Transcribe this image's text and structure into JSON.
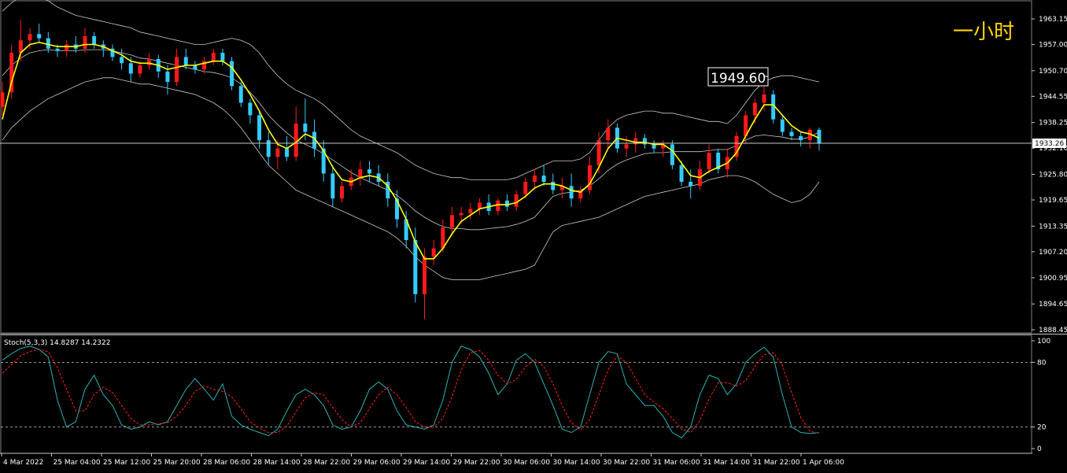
{
  "period_label": "一小时",
  "main_panel": {
    "price_axis_ticks": [
      "1963.15",
      "1957.00",
      "1950.70",
      "1944.55",
      "1938.25",
      "1932.10",
      "1925.80",
      "1919.65",
      "1913.35",
      "1907.20",
      "1900.95",
      "1894.65",
      "1888.45"
    ],
    "current_price": "1933.26",
    "annotation_price": "1949.60",
    "colors": {
      "bull": "#ff1a1a",
      "bear": "#33ccff",
      "ma": "#ffff00",
      "band": "#c8c8c8",
      "hline": "#c8c8c8",
      "current_box": "#ffffff"
    }
  },
  "stoch_panel": {
    "title": "Stoch(5,3,3) 14.8287 14.2322",
    "axis_ticks": [
      "100",
      "80",
      "20",
      "0"
    ],
    "colors": {
      "main": "#2bb3b3",
      "signal": "#ff2020"
    }
  },
  "time_axis": [
    "4 Mar 2022",
    "25 Mar 04:00",
    "25 Mar 12:00",
    "25 Mar 20:00",
    "28 Mar 06:00",
    "28 Mar 14:00",
    "28 Mar 22:00",
    "29 Mar 06:00",
    "29 Mar 14:00",
    "29 Mar 22:00",
    "30 Mar 06:00",
    "30 Mar 14:00",
    "30 Mar 22:00",
    "31 Mar 06:00",
    "31 Mar 14:00",
    "31 Mar 22:00",
    "1 Apr 06:00"
  ],
  "chart_data": {
    "type": "candlestick",
    "title": "",
    "indicators": [
      "Bollinger Bands",
      "Moving Average",
      "Stoch(5,3,3)"
    ],
    "y_range": [
      1888.45,
      1966.0
    ],
    "candles_ohlc": [
      [
        1942.0,
        1948.0,
        1940.0,
        1945.5
      ],
      [
        1945.5,
        1957.0,
        1944.0,
        1955.0
      ],
      [
        1955.0,
        1963.0,
        1953.0,
        1958.0
      ],
      [
        1958.0,
        1961.0,
        1956.0,
        1959.5
      ],
      [
        1959.5,
        1962.0,
        1957.5,
        1958.5
      ],
      [
        1958.5,
        1960.0,
        1955.0,
        1956.0
      ],
      [
        1956.0,
        1957.0,
        1954.0,
        1955.5
      ],
      [
        1955.5,
        1958.0,
        1954.0,
        1957.0
      ],
      [
        1957.0,
        1959.0,
        1955.0,
        1956.0
      ],
      [
        1956.0,
        1961.0,
        1955.0,
        1959.0
      ],
      [
        1959.0,
        1960.0,
        1956.0,
        1957.0
      ],
      [
        1957.0,
        1958.0,
        1954.0,
        1956.0
      ],
      [
        1956.0,
        1957.0,
        1953.0,
        1954.0
      ],
      [
        1954.0,
        1956.0,
        1951.0,
        1952.5
      ],
      [
        1952.5,
        1954.0,
        1948.0,
        1950.0
      ],
      [
        1950.0,
        1953.0,
        1949.0,
        1952.0
      ],
      [
        1952.0,
        1955.0,
        1951.0,
        1953.5
      ],
      [
        1953.5,
        1954.5,
        1949.0,
        1950.5
      ],
      [
        1950.5,
        1952.0,
        1945.0,
        1948.0
      ],
      [
        1948.0,
        1956.0,
        1947.0,
        1954.0
      ],
      [
        1954.0,
        1956.0,
        1951.0,
        1952.0
      ],
      [
        1952.0,
        1953.0,
        1950.0,
        1951.0
      ],
      [
        1951.0,
        1954.0,
        1950.0,
        1953.0
      ],
      [
        1953.0,
        1956.0,
        1952.0,
        1955.0
      ],
      [
        1955.0,
        1956.0,
        1952.0,
        1953.0
      ],
      [
        1953.0,
        1954.0,
        1946.0,
        1947.0
      ],
      [
        1947.0,
        1948.0,
        1942.0,
        1943.0
      ],
      [
        1943.0,
        1944.0,
        1938.0,
        1940.0
      ],
      [
        1940.0,
        1941.0,
        1932.0,
        1934.0
      ],
      [
        1934.0,
        1936.0,
        1928.0,
        1930.0
      ],
      [
        1930.0,
        1934.0,
        1927.0,
        1932.0
      ],
      [
        1932.0,
        1935.0,
        1929.0,
        1930.0
      ],
      [
        1930.0,
        1942.0,
        1929.0,
        1938.0
      ],
      [
        1938.0,
        1944.0,
        1934.0,
        1936.0
      ],
      [
        1936.0,
        1939.0,
        1930.0,
        1932.0
      ],
      [
        1932.0,
        1934.0,
        1924.0,
        1926.0
      ],
      [
        1926.0,
        1928.0,
        1918.0,
        1920.0
      ],
      [
        1920.0,
        1924.0,
        1919.0,
        1923.0
      ],
      [
        1923.0,
        1927.0,
        1922.0,
        1925.0
      ],
      [
        1925.0,
        1929.0,
        1923.0,
        1927.0
      ],
      [
        1927.0,
        1929.0,
        1924.0,
        1926.0
      ],
      [
        1926.0,
        1928.0,
        1923.0,
        1924.0
      ],
      [
        1924.0,
        1926.0,
        1918.0,
        1920.0
      ],
      [
        1920.0,
        1922.0,
        1913.0,
        1915.0
      ],
      [
        1915.0,
        1917.0,
        1908.0,
        1910.0
      ],
      [
        1910.0,
        1913.0,
        1895.0,
        1897.0
      ],
      [
        1897.0,
        1908.0,
        1891.0,
        1906.0
      ],
      [
        1906.0,
        1910.0,
        1904.0,
        1908.0
      ],
      [
        1908.0,
        1915.0,
        1907.0,
        1913.0
      ],
      [
        1913.0,
        1918.0,
        1911.0,
        1916.0
      ],
      [
        1916.0,
        1918.0,
        1914.0,
        1916.5
      ],
      [
        1916.5,
        1919.0,
        1915.0,
        1917.5
      ],
      [
        1917.5,
        1920.0,
        1916.0,
        1919.0
      ],
      [
        1919.0,
        1921.0,
        1916.0,
        1917.0
      ],
      [
        1917.0,
        1920.0,
        1916.0,
        1919.5
      ],
      [
        1919.5,
        1921.0,
        1917.0,
        1918.0
      ],
      [
        1918.0,
        1922.0,
        1917.0,
        1921.0
      ],
      [
        1921.0,
        1925.0,
        1920.0,
        1924.0
      ],
      [
        1924.0,
        1927.0,
        1922.0,
        1925.5
      ],
      [
        1925.5,
        1928.0,
        1923.0,
        1924.0
      ],
      [
        1924.0,
        1926.0,
        1921.0,
        1922.0
      ],
      [
        1922.0,
        1925.0,
        1920.0,
        1923.0
      ],
      [
        1923.0,
        1926.0,
        1918.0,
        1920.0
      ],
      [
        1920.0,
        1923.0,
        1919.0,
        1922.0
      ],
      [
        1922.0,
        1930.0,
        1921.0,
        1928.0
      ],
      [
        1928.0,
        1936.0,
        1926.0,
        1934.0
      ],
      [
        1934.0,
        1939.0,
        1932.0,
        1937.0
      ],
      [
        1937.0,
        1938.0,
        1931.0,
        1932.0
      ],
      [
        1932.0,
        1935.0,
        1930.0,
        1933.0
      ],
      [
        1933.0,
        1936.0,
        1931.0,
        1934.5
      ],
      [
        1934.5,
        1935.5,
        1932.0,
        1933.0
      ],
      [
        1933.0,
        1934.0,
        1931.0,
        1932.0
      ],
      [
        1932.0,
        1934.0,
        1930.0,
        1933.0
      ],
      [
        1933.0,
        1934.0,
        1927.0,
        1928.0
      ],
      [
        1928.0,
        1929.0,
        1923.0,
        1924.0
      ],
      [
        1924.0,
        1927.0,
        1920.0,
        1923.0
      ],
      [
        1923.0,
        1929.0,
        1922.0,
        1927.0
      ],
      [
        1927.0,
        1933.0,
        1926.0,
        1931.0
      ],
      [
        1931.0,
        1932.0,
        1926.0,
        1927.0
      ],
      [
        1927.0,
        1932.0,
        1925.0,
        1930.0
      ],
      [
        1930.0,
        1936.0,
        1929.0,
        1935.0
      ],
      [
        1935.0,
        1941.0,
        1933.0,
        1940.0
      ],
      [
        1940.0,
        1944.0,
        1938.0,
        1943.0
      ],
      [
        1943.0,
        1949.6,
        1941.0,
        1945.0
      ],
      [
        1945.0,
        1946.0,
        1938.0,
        1939.0
      ],
      [
        1939.0,
        1940.0,
        1935.0,
        1936.0
      ],
      [
        1936.0,
        1937.0,
        1934.0,
        1935.0
      ],
      [
        1935.0,
        1936.0,
        1932.5,
        1934.0
      ],
      [
        1934.0,
        1937.0,
        1932.0,
        1936.5
      ],
      [
        1936.5,
        1937.0,
        1931.5,
        1933.26
      ]
    ],
    "ma": [
      1939.0,
      1948.0,
      1955.0,
      1957.0,
      1957.5,
      1957.0,
      1956.5,
      1956.5,
      1956.5,
      1957.0,
      1957.0,
      1956.5,
      1955.5,
      1954.5,
      1953.0,
      1952.5,
      1952.5,
      1952.0,
      1951.0,
      1951.5,
      1952.0,
      1952.0,
      1952.5,
      1953.0,
      1953.0,
      1951.5,
      1948.5,
      1945.0,
      1941.0,
      1936.5,
      1933.0,
      1932.0,
      1933.5,
      1935.5,
      1934.5,
      1931.5,
      1927.5,
      1924.5,
      1924.0,
      1925.0,
      1925.5,
      1925.0,
      1923.0,
      1919.5,
      1915.0,
      1909.5,
      1905.5,
      1905.5,
      1908.0,
      1911.5,
      1914.5,
      1916.0,
      1917.5,
      1918.0,
      1918.5,
      1918.5,
      1919.0,
      1920.5,
      1922.5,
      1923.5,
      1923.5,
      1923.0,
      1922.0,
      1921.5,
      1923.5,
      1927.5,
      1932.0,
      1934.5,
      1934.0,
      1933.5,
      1933.5,
      1933.0,
      1933.0,
      1931.5,
      1928.5,
      1925.5,
      1925.0,
      1926.5,
      1927.5,
      1928.5,
      1931.0,
      1935.0,
      1939.0,
      1942.5,
      1942.5,
      1940.0,
      1937.5,
      1936.0,
      1935.5,
      1934.5
    ],
    "bb_upper": [
      1965.0,
      1967.0,
      1968.5,
      1969.0,
      1968.5,
      1967.5,
      1966.0,
      1965.0,
      1964.0,
      1963.5,
      1963.0,
      1962.5,
      1962.0,
      1961.5,
      1961.0,
      1960.0,
      1959.5,
      1959.0,
      1958.5,
      1958.0,
      1957.5,
      1957.0,
      1957.0,
      1957.5,
      1958.0,
      1958.5,
      1958.0,
      1957.0,
      1955.0,
      1952.0,
      1949.5,
      1947.5,
      1946.0,
      1945.0,
      1944.0,
      1942.5,
      1940.5,
      1938.5,
      1936.5,
      1935.0,
      1934.0,
      1933.0,
      1932.0,
      1931.0,
      1929.5,
      1928.0,
      1927.0,
      1926.0,
      1925.5,
      1925.0,
      1925.0,
      1924.5,
      1924.5,
      1924.5,
      1924.5,
      1924.5,
      1925.0,
      1926.0,
      1927.0,
      1928.0,
      1929.0,
      1929.0,
      1929.0,
      1929.5,
      1931.0,
      1934.0,
      1937.0,
      1939.0,
      1940.0,
      1940.5,
      1941.0,
      1941.0,
      1940.5,
      1940.5,
      1940.0,
      1939.5,
      1939.0,
      1938.5,
      1938.5,
      1938.0,
      1940.0,
      1943.0,
      1946.0,
      1948.0,
      1949.0,
      1949.5,
      1949.5,
      1949.0,
      1948.5,
      1948.0
    ],
    "bb_lower": [
      1934.0,
      1937.0,
      1939.0,
      1941.0,
      1942.5,
      1944.0,
      1945.0,
      1946.0,
      1947.0,
      1948.0,
      1948.5,
      1949.0,
      1949.0,
      1948.5,
      1948.0,
      1947.5,
      1947.5,
      1947.0,
      1946.5,
      1946.0,
      1945.5,
      1945.0,
      1944.0,
      1943.0,
      1941.5,
      1939.5,
      1937.0,
      1934.0,
      1931.0,
      1928.0,
      1926.0,
      1924.0,
      1922.0,
      1921.0,
      1920.0,
      1919.0,
      1918.0,
      1917.0,
      1916.0,
      1915.0,
      1914.0,
      1913.0,
      1912.0,
      1910.5,
      1908.5,
      1906.0,
      1904.0,
      1902.5,
      1901.0,
      1900.5,
      1900.5,
      1900.5,
      1900.5,
      1901.0,
      1901.5,
      1902.0,
      1902.5,
      1903.0,
      1904.0,
      1908.0,
      1912.0,
      1913.5,
      1914.0,
      1914.5,
      1915.0,
      1915.5,
      1916.5,
      1917.5,
      1918.5,
      1919.5,
      1920.5,
      1921.0,
      1921.5,
      1922.0,
      1922.5,
      1923.0,
      1923.5,
      1924.5,
      1925.0,
      1925.5,
      1925.5,
      1925.0,
      1924.0,
      1922.5,
      1921.0,
      1920.0,
      1919.0,
      1919.5,
      1921.0,
      1924.0
    ],
    "stoch_main": [
      82,
      88,
      93,
      95,
      92,
      85,
      45,
      20,
      25,
      55,
      68,
      50,
      40,
      22,
      18,
      20,
      25,
      22,
      25,
      40,
      55,
      65,
      55,
      45,
      60,
      30,
      22,
      18,
      15,
      12,
      18,
      35,
      50,
      55,
      50,
      40,
      22,
      18,
      20,
      35,
      55,
      62,
      55,
      35,
      22,
      20,
      18,
      22,
      45,
      80,
      95,
      92,
      85,
      70,
      50,
      60,
      82,
      88,
      80,
      60,
      40,
      18,
      15,
      20,
      50,
      80,
      90,
      88,
      60,
      50,
      40,
      40,
      30,
      15,
      10,
      20,
      50,
      68,
      65,
      50,
      60,
      80,
      88,
      94,
      85,
      50,
      20,
      15,
      14,
      14.8
    ],
    "stoch_signal": [
      70,
      78,
      86,
      90,
      92,
      90,
      75,
      55,
      35,
      35,
      50,
      57,
      52,
      40,
      28,
      22,
      22,
      23,
      24,
      30,
      40,
      53,
      58,
      55,
      53,
      48,
      37,
      25,
      19,
      15,
      15,
      21,
      34,
      47,
      52,
      50,
      38,
      27,
      20,
      24,
      37,
      50,
      57,
      50,
      38,
      25,
      20,
      20,
      28,
      48,
      73,
      89,
      91,
      82,
      68,
      60,
      64,
      76,
      83,
      76,
      60,
      40,
      24,
      17,
      27,
      50,
      73,
      86,
      80,
      65,
      50,
      43,
      37,
      28,
      18,
      15,
      26,
      46,
      61,
      61,
      58,
      63,
      76,
      87,
      89,
      77,
      52,
      29,
      16,
      14.2
    ]
  }
}
